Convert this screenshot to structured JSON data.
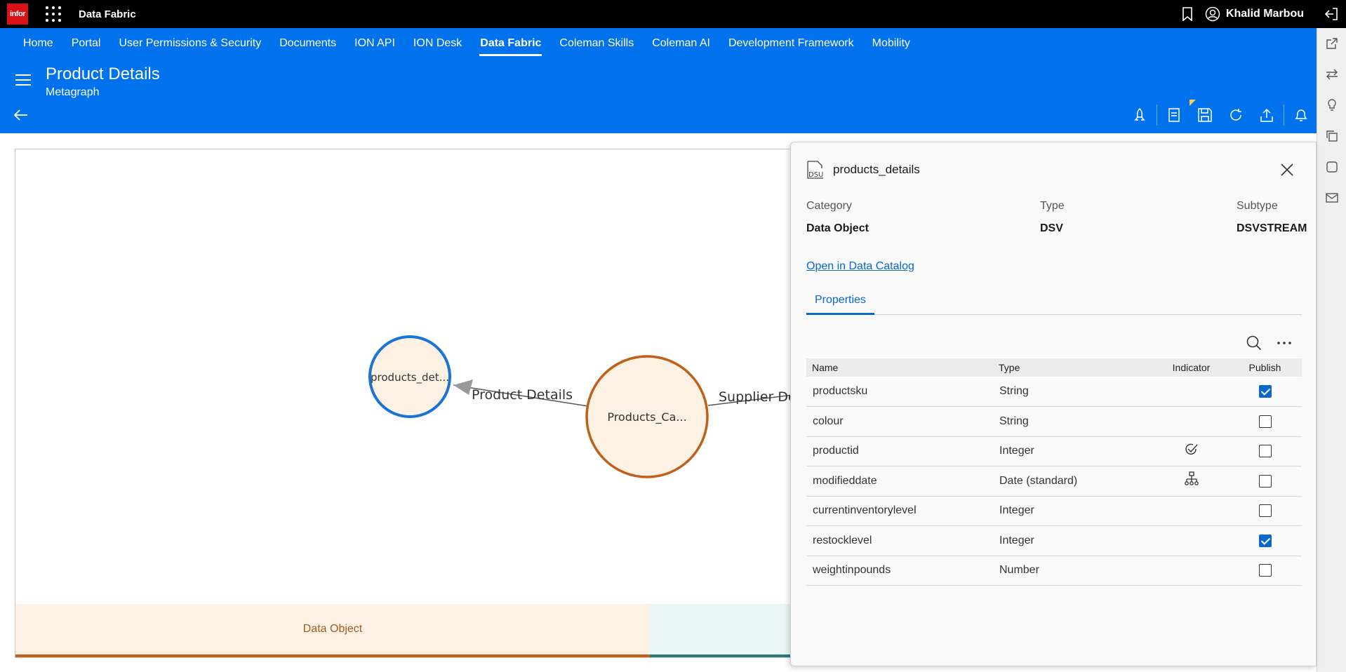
{
  "topbar": {
    "logo": "infor",
    "app_title": "Data Fabric",
    "user_name": "Khalid Marbou",
    "icons": [
      "grid-icon",
      "bookmark-icon",
      "user-icon",
      "sign-out-icon"
    ]
  },
  "nav": {
    "items": [
      "Home",
      "Portal",
      "User Permissions & Security",
      "Documents",
      "ION API",
      "ION Desk",
      "Data Fabric",
      "Coleman Skills",
      "Coleman AI",
      "Development Framework",
      "Mobility"
    ],
    "active": "Data Fabric"
  },
  "page": {
    "title": "Product Details",
    "subtitle": "Metagraph"
  },
  "toolbar": {
    "icons": [
      "rocket-icon",
      "document-icon",
      "save-icon",
      "refresh-icon",
      "upload-icon",
      "bell-icon"
    ]
  },
  "rail": {
    "icons": [
      "external-link-icon",
      "swap-icon",
      "lightbulb-icon",
      "copy-icon",
      "square-icon",
      "mail-icon"
    ]
  },
  "graph": {
    "nodes": [
      {
        "label": "products_det..."
      },
      {
        "label": "Products_Ca..."
      }
    ],
    "edges": [
      {
        "label": "Product Details"
      },
      {
        "label": "Supplier De"
      }
    ],
    "colors": {
      "selected_border": "#1a73d6",
      "object_border": "#c0601a",
      "node_fill": "#fdf1e3"
    }
  },
  "legend": {
    "item1": "Data Object"
  },
  "panel": {
    "title": "products_details",
    "icon_label": "DSU",
    "category_label": "Category",
    "category_value": "Data Object",
    "type_label": "Type",
    "type_value": "DSV",
    "subtype_label": "Subtype",
    "subtype_value": "DSVSTREAM",
    "catalog_link": "Open in Data Catalog",
    "tab": "Properties",
    "columns": {
      "name": "Name",
      "type": "Type",
      "indicator": "Indicator",
      "publish": "Publish"
    },
    "rows": [
      {
        "name": "productsku",
        "type": "String",
        "indicator": "",
        "publish": true
      },
      {
        "name": "colour",
        "type": "String",
        "indicator": "",
        "publish": false
      },
      {
        "name": "productid",
        "type": "Integer",
        "indicator": "identifier-icon",
        "publish": false
      },
      {
        "name": "modifieddate",
        "type": "Date (standard)",
        "indicator": "hierarchy-icon",
        "publish": false
      },
      {
        "name": "currentinventorylevel",
        "type": "Integer",
        "indicator": "",
        "publish": false
      },
      {
        "name": "restocklevel",
        "type": "Integer",
        "indicator": "",
        "publish": true
      },
      {
        "name": "weightinpounds",
        "type": "Number",
        "indicator": "",
        "publish": false
      }
    ]
  }
}
